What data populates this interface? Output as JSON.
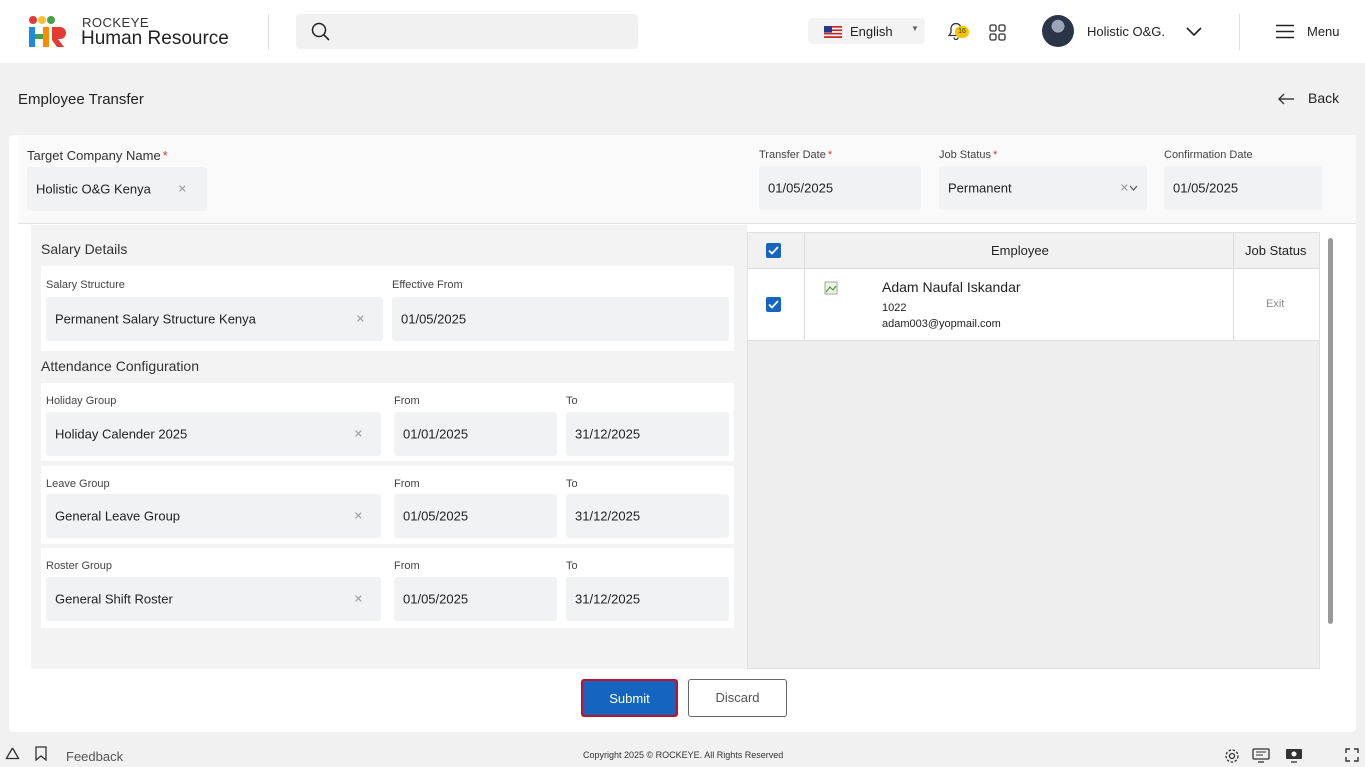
{
  "header": {
    "brand_top": "ROCKEYE",
    "brand_main": "Human Resource",
    "search_placeholder": "",
    "language": "English",
    "notification_count": "16",
    "user_name": "Holistic O&G.",
    "menu_label": "Menu"
  },
  "page": {
    "title": "Employee Transfer",
    "back_label": "Back"
  },
  "transfer": {
    "target_company_label": "Target Company Name",
    "target_company_value": "Holistic O&G Kenya",
    "transfer_date_label": "Transfer Date",
    "transfer_date_value": "01/05/2025",
    "job_status_label": "Job Status",
    "job_status_value": "Permanent",
    "confirmation_date_label": "Confirmation Date",
    "confirmation_date_value": "01/05/2025",
    "required_mark": "*"
  },
  "salary": {
    "section_title": "Salary Details",
    "structure_label": "Salary Structure",
    "structure_value": "Permanent Salary Structure Kenya",
    "effective_label": "Effective From",
    "effective_value": "01/05/2025"
  },
  "attendance": {
    "section_title": "Attendance Configuration",
    "from_label": "From",
    "to_label": "To",
    "groups": [
      {
        "label": "Holiday Group",
        "value": "Holiday Calender 2025",
        "from": "01/01/2025",
        "to": "31/12/2025"
      },
      {
        "label": "Leave Group",
        "value": "General Leave Group",
        "from": "01/05/2025",
        "to": "31/12/2025"
      },
      {
        "label": "Roster Group",
        "value": "General Shift Roster",
        "from": "01/05/2025",
        "to": "31/12/2025"
      }
    ]
  },
  "employee_table": {
    "col_employee": "Employee",
    "col_job_status": "Job Status",
    "rows": [
      {
        "name": "Adam Naufal Iskandar",
        "id": "1022",
        "email": "adam003@yopmail.com",
        "job_status": "Exit",
        "checked": true
      }
    ]
  },
  "actions": {
    "submit": "Submit",
    "discard": "Discard"
  },
  "footer": {
    "feedback": "Feedback",
    "copyright": "Copyright 2025 © ROCKEYE. All Rights Reserved"
  },
  "colors": {
    "primary": "#1565c0",
    "submit_border": "#c0102a",
    "badge": "#f4c300"
  }
}
